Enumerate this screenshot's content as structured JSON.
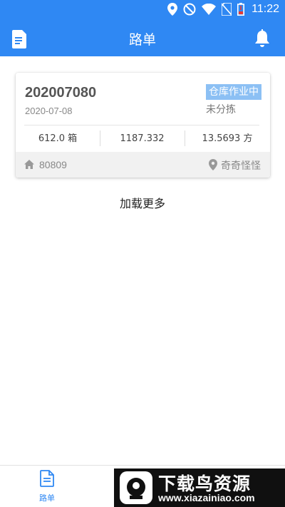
{
  "status_bar": {
    "time": "11:22",
    "icons": [
      "location-icon",
      "do-not-disturb-icon",
      "wifi-icon",
      "no-sim-icon",
      "battery-low-icon"
    ]
  },
  "app_bar": {
    "title": "路单",
    "left_icon": "document-icon",
    "right_icon": "bell-icon"
  },
  "orders": [
    {
      "number": "202007080",
      "date": "2020-07-08",
      "status_badge": "仓库作业中",
      "sub_status": "未分拣",
      "metrics": [
        "612.0 箱",
        "1187.332",
        "13.5693 方"
      ],
      "code": "80809",
      "name": "奇奇怪怪"
    }
  ],
  "load_more": "加载更多",
  "tab_bar": {
    "tabs": [
      {
        "label": "路单",
        "icon": "document-icon",
        "active": true
      }
    ]
  },
  "watermark": {
    "title": "下载鸟资源",
    "url": "www.xiazainiao.com"
  },
  "colors": {
    "primary": "#2f88f3",
    "badge": "#8cc0f4",
    "footer_bg": "#f1f1f1"
  }
}
